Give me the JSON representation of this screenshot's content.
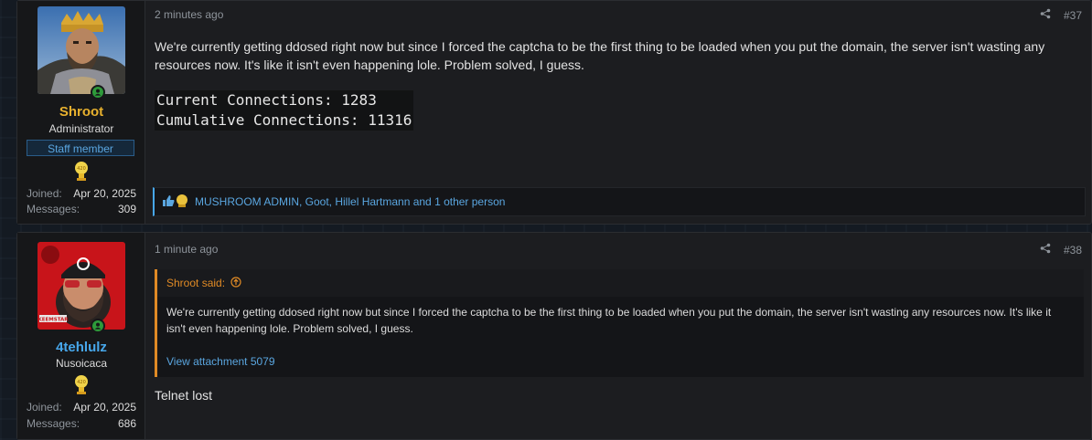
{
  "posts": [
    {
      "username": "Shroot",
      "user_title": "Administrator",
      "staff_badge": "Staff member",
      "stats": [
        {
          "label": "Joined:",
          "value": "Apr 20, 2025"
        },
        {
          "label": "Messages:",
          "value": "309"
        }
      ],
      "date": "2 minutes ago",
      "number": "#37",
      "body": "We're currently getting ddosed right now but since I forced the captcha to be the first thing to be loaded when you put the domain, the server isn't wasting any resources now. It's like it isn't even happening lole. Problem solved, I guess.",
      "code_lines": [
        "Current Connections: 1283",
        "Cumulative Connections: 11316"
      ],
      "reactions": "MUSHROOM ADMIN, Goot, Hillel Hartmann and 1 other person"
    },
    {
      "username": "4tehlulz",
      "user_title": "Nusoicaca",
      "stats": [
        {
          "label": "Joined:",
          "value": "Apr 20, 2025"
        },
        {
          "label": "Messages:",
          "value": "686"
        }
      ],
      "date": "1 minute ago",
      "number": "#38",
      "quote": {
        "author": "Shroot said:",
        "text": "We're currently getting ddosed right now but since I forced the captcha to be the first thing to be loaded when you put the domain, the server isn't wasting any resources now. It's like it isn't even happening lole. Problem solved, I guess.",
        "attachment_link": "View attachment 5079"
      },
      "body": "Telnet lost",
      "avatar_badge": "KEEMSTAR"
    }
  ],
  "colors": {
    "admin_name": "#e8b12e",
    "member_name": "#47a7eb",
    "link": "#5aa6e0",
    "quote_accent": "#e08a25"
  },
  "icons": [
    "share-icon",
    "online-user-icon",
    "trophy-icon",
    "like-icon",
    "arrow-up-circle-icon"
  ]
}
